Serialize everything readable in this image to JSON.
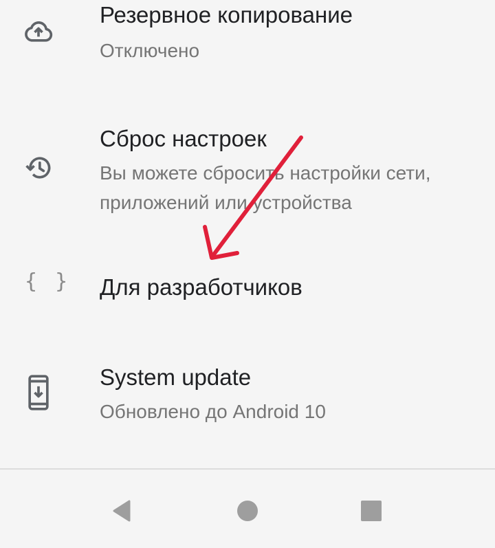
{
  "settings": {
    "backup": {
      "title": "Резервное копирование",
      "summary": "Отключено",
      "icon": "cloud-upload-icon"
    },
    "reset": {
      "title": "Сброс настроек",
      "summary": "Вы можете сбросить настройки сети, приложений или устройства",
      "icon": "history-icon"
    },
    "developer": {
      "title": "Для разработчиков",
      "icon": "braces-icon",
      "icon_glyph": "{ }"
    },
    "system_update": {
      "title": "System update",
      "summary": "Обновлено до Android 10",
      "icon": "phone-download-icon"
    }
  },
  "navbar": {
    "back": "back-triangle-icon",
    "home": "home-circle-icon",
    "recents": "recents-square-icon"
  },
  "annotation": {
    "color": "#e0203a"
  },
  "colors": {
    "background": "#f5f5f5",
    "title": "#202124",
    "summary": "#757575",
    "icon": "#5f6368",
    "nav_icon": "#9e9e9e"
  }
}
